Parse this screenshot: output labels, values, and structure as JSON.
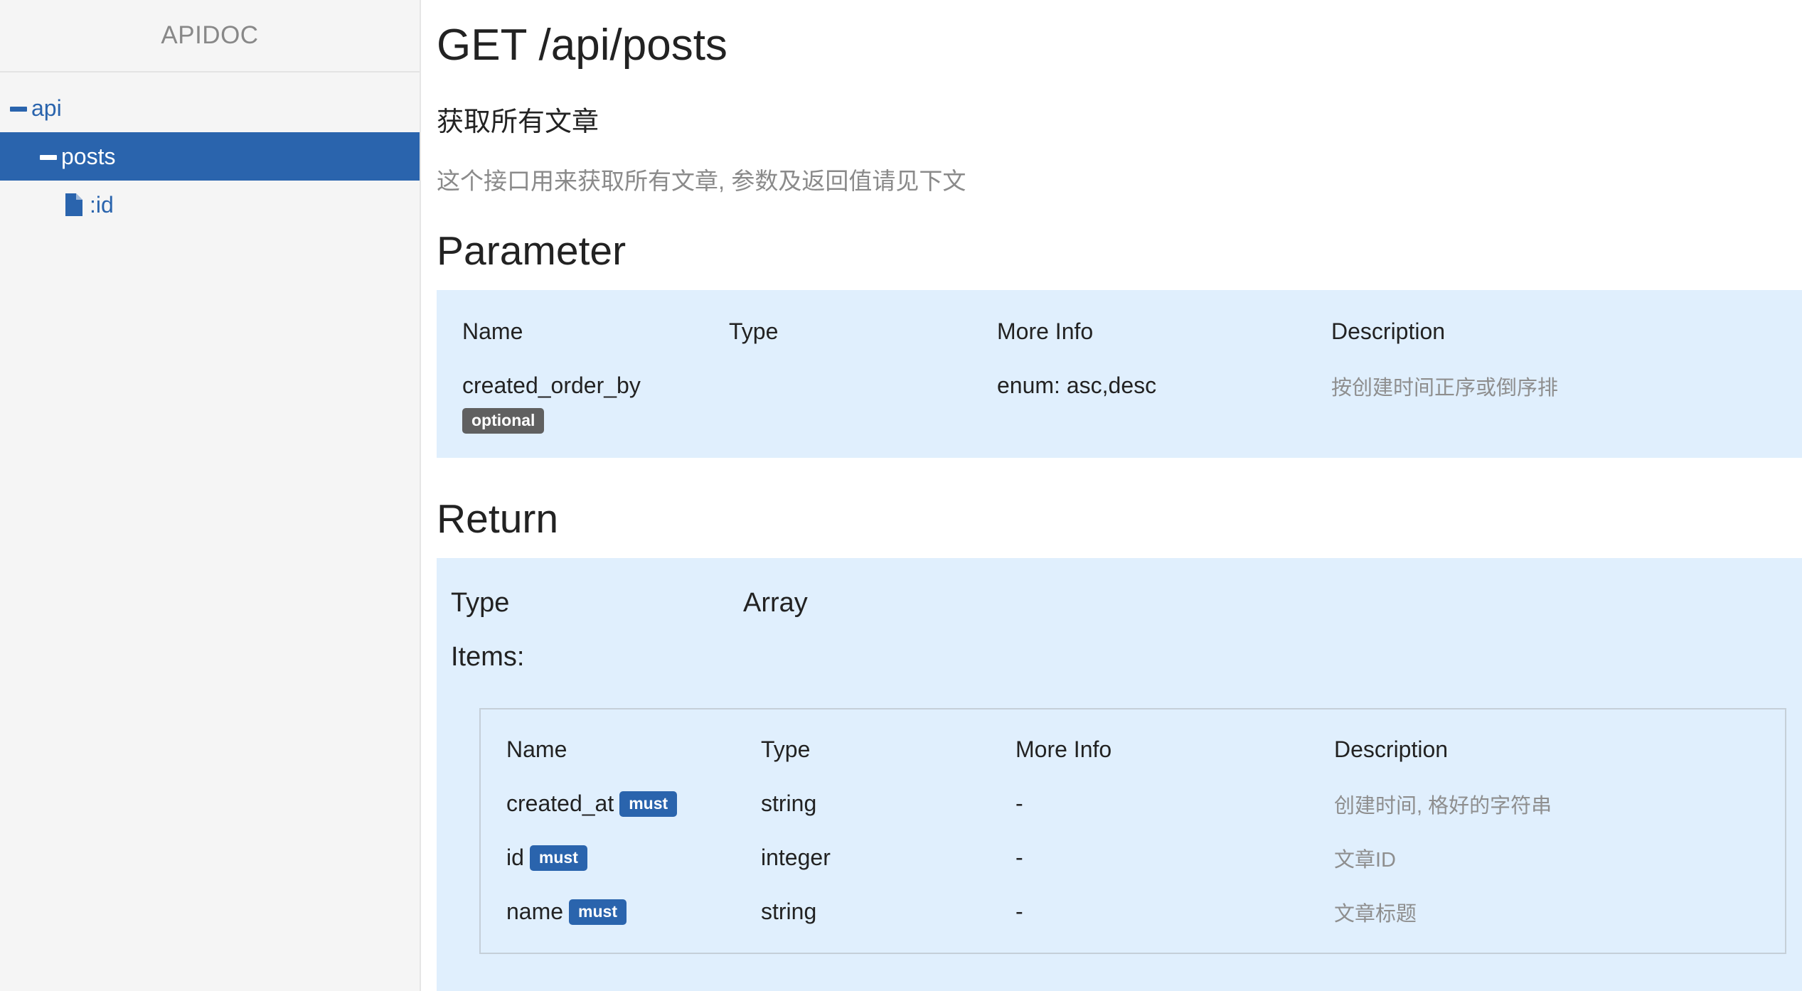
{
  "sidebar": {
    "brand": "APIDOC",
    "items": [
      {
        "label": "api",
        "icon": "minus-icon"
      },
      {
        "label": "posts",
        "icon": "minus-icon",
        "active": true
      },
      {
        "label": ":id",
        "icon": "file-icon"
      }
    ]
  },
  "endpoint": {
    "title": "GET /api/posts",
    "summary": "获取所有文章",
    "description": "这个接口用来获取所有文章, 参数及返回值请见下文"
  },
  "parameter": {
    "heading": "Parameter",
    "columns": [
      "Name",
      "Type",
      "More Info",
      "Description"
    ],
    "rows": [
      {
        "name": "created_order_by",
        "badge": "optional",
        "type": "",
        "more_info": "enum: asc,desc",
        "description": "按创建时间正序或倒序排"
      }
    ]
  },
  "return": {
    "heading": "Return",
    "type_label": "Type",
    "type_value": "Array",
    "items_label": "Items:",
    "columns": [
      "Name",
      "Type",
      "More Info",
      "Description"
    ],
    "rows": [
      {
        "name": "created_at",
        "badge": "must",
        "type": "string",
        "more_info": "-",
        "description": "创建时间, 格好的字符串"
      },
      {
        "name": "id",
        "badge": "must",
        "type": "integer",
        "more_info": "-",
        "description": "文章ID"
      },
      {
        "name": "name",
        "badge": "must",
        "type": "string",
        "more_info": "-",
        "description": "文章标题"
      }
    ]
  },
  "colors": {
    "accent": "#2a64ad",
    "panel_bg": "#e0effd",
    "optional_badge": "#606060",
    "sidebar_bg": "#f5f5f5"
  }
}
